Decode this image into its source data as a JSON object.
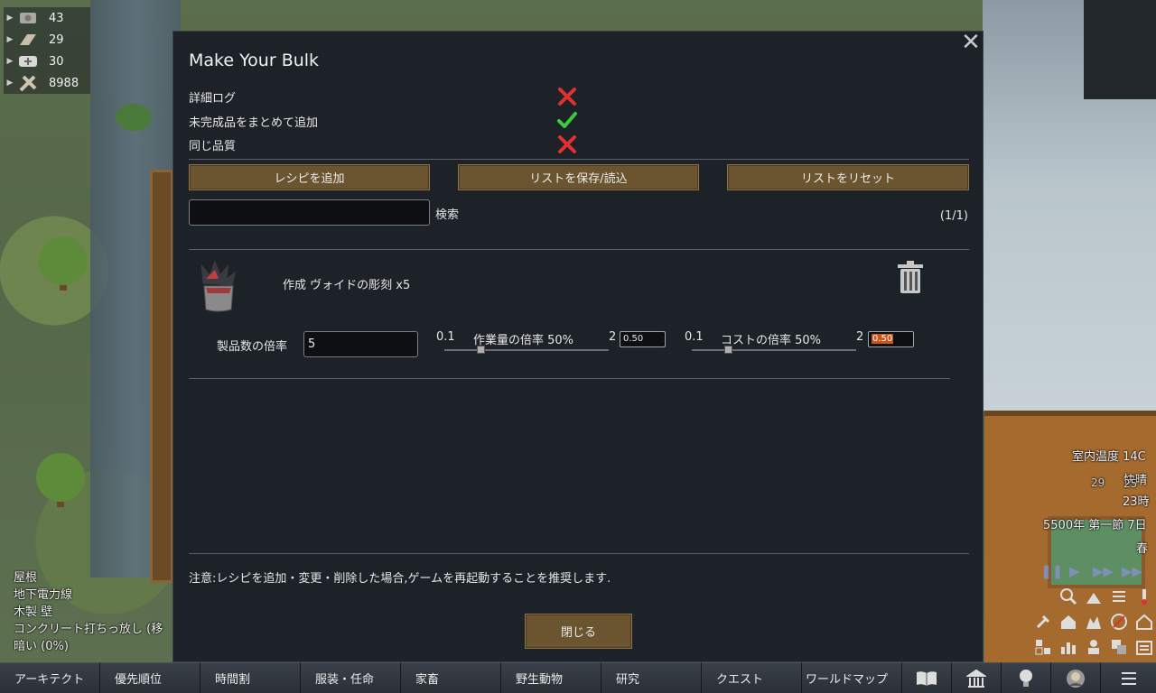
{
  "resources": [
    {
      "icon": "silver-icon",
      "value": "43"
    },
    {
      "icon": "wood-icon",
      "value": "29"
    },
    {
      "icon": "medicine-icon",
      "value": "30"
    },
    {
      "icon": "steel-icon",
      "value": "8988"
    }
  ],
  "dialog": {
    "close_symbol": "✕",
    "title": "Make Your Bulk",
    "options": [
      {
        "label": "詳細ログ",
        "state": "off"
      },
      {
        "label": "未完成品をまとめて追加",
        "state": "on"
      },
      {
        "label": "同じ品質",
        "state": "off"
      }
    ],
    "buttons": {
      "add_recipe": "レシピを追加",
      "save_load": "リストを保存/読込",
      "reset": "リストをリセット"
    },
    "search": {
      "value": "",
      "label": "検索"
    },
    "page_count": "(1/1)",
    "recipe": {
      "name": "作成 ヴォイドの彫刻 x5",
      "product_multiplier_label": "製品数の倍率",
      "product_multiplier_value": "5",
      "work_slider": {
        "min": "0.1",
        "title": "作業量の倍率 50%",
        "max": "2",
        "value": "0.50",
        "fraction": 0.22
      },
      "cost_slider": {
        "min": "0.1",
        "title": "コストの倍率 50%",
        "max": "2",
        "value": "0.50",
        "fraction": 0.22
      }
    },
    "note": "注意:レシピを追加・変更・削除した場合,ゲームを再起動することを推奨します.",
    "close_label": "閉じる"
  },
  "hud": {
    "temperature": "室内温度 14C",
    "weather": "快晴",
    "colonists": "29",
    "count2": "25",
    "hour": "23時",
    "date": "5500年 第一節 7日",
    "season": "春"
  },
  "info_panel": [
    "屋根",
    "地下電力線",
    "木製 壁",
    "コンクリート打ちっ放し (移",
    "暗い (0%)"
  ],
  "bottom_tabs": [
    "アーキテクト",
    "優先順位",
    "時間割",
    "服装・任命",
    "家畜",
    "野生動物",
    "研究",
    "クエスト",
    "ワールドマップ"
  ],
  "colors": {
    "accent_button": "#6b5430",
    "check_green": "#3ec83e",
    "cross_red": "#e03030"
  }
}
